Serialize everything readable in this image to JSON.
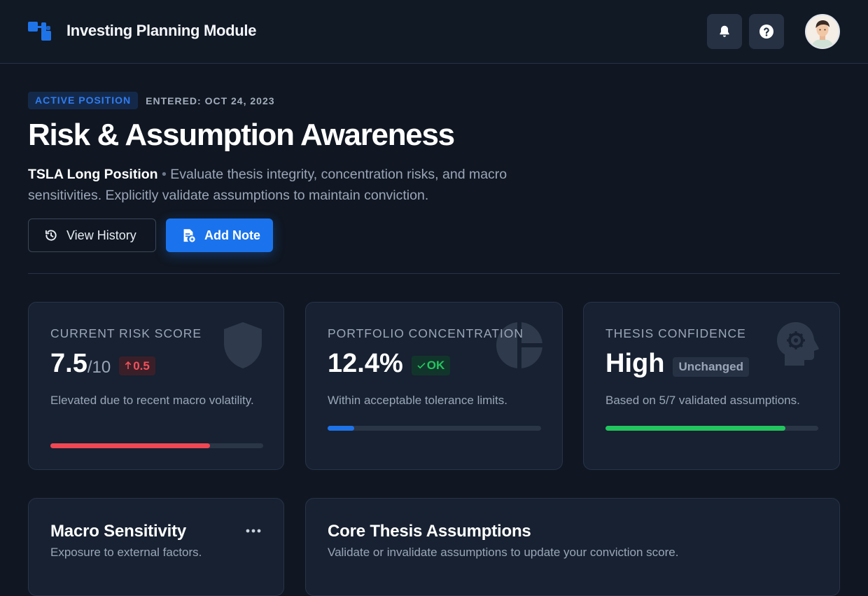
{
  "app": {
    "title": "Investing Planning Module"
  },
  "header": {
    "notifications_icon": "bell-icon",
    "help_icon": "help-icon",
    "avatar": "user-avatar"
  },
  "hero": {
    "status_badge": "ACTIVE POSITION",
    "entered": "ENTERED: OCT 24, 2023",
    "title": "Risk & Assumption Awareness",
    "position_name": "TSLA Long Position",
    "bullet": "•",
    "description": "Evaluate thesis integrity, concentration risks, and macro sensitivities. Explicitly validate assumptions to maintain conviction.",
    "view_history_label": "View History",
    "add_note_label": "Add Note"
  },
  "cards": {
    "risk": {
      "label": "CURRENT RISK SCORE",
      "value": "7.5",
      "suffix": "/10",
      "delta": "0.5",
      "delta_color": "#f0525b",
      "description": "Elevated due to recent macro volatility.",
      "progress": 0.75,
      "bar_color": "#ef4753",
      "icon": "shield-icon"
    },
    "concentration": {
      "label": "PORTFOLIO CONCENTRATION",
      "value": "12.4%",
      "status": "OK",
      "status_color": "#22c55e",
      "description": "Within acceptable tolerance limits.",
      "progress": 0.124,
      "bar_color": "#1f73e8",
      "icon": "pie-chart-icon"
    },
    "confidence": {
      "label": "THESIS CONFIDENCE",
      "value": "High",
      "status": "Unchanged",
      "description": "Based on 5/7 validated assumptions.",
      "progress": 0.846,
      "bar_color": "#22c55e",
      "icon": "head-gear-icon"
    }
  },
  "panels": {
    "macro": {
      "title": "Macro Sensitivity",
      "subtitle": "Exposure to external factors."
    },
    "thesis": {
      "title": "Core Thesis Assumptions",
      "subtitle": "Validate or invalidate assumptions to update your conviction score."
    }
  },
  "colors": {
    "accent": "#1a73ec",
    "background": "#101722",
    "card": "#172131"
  }
}
